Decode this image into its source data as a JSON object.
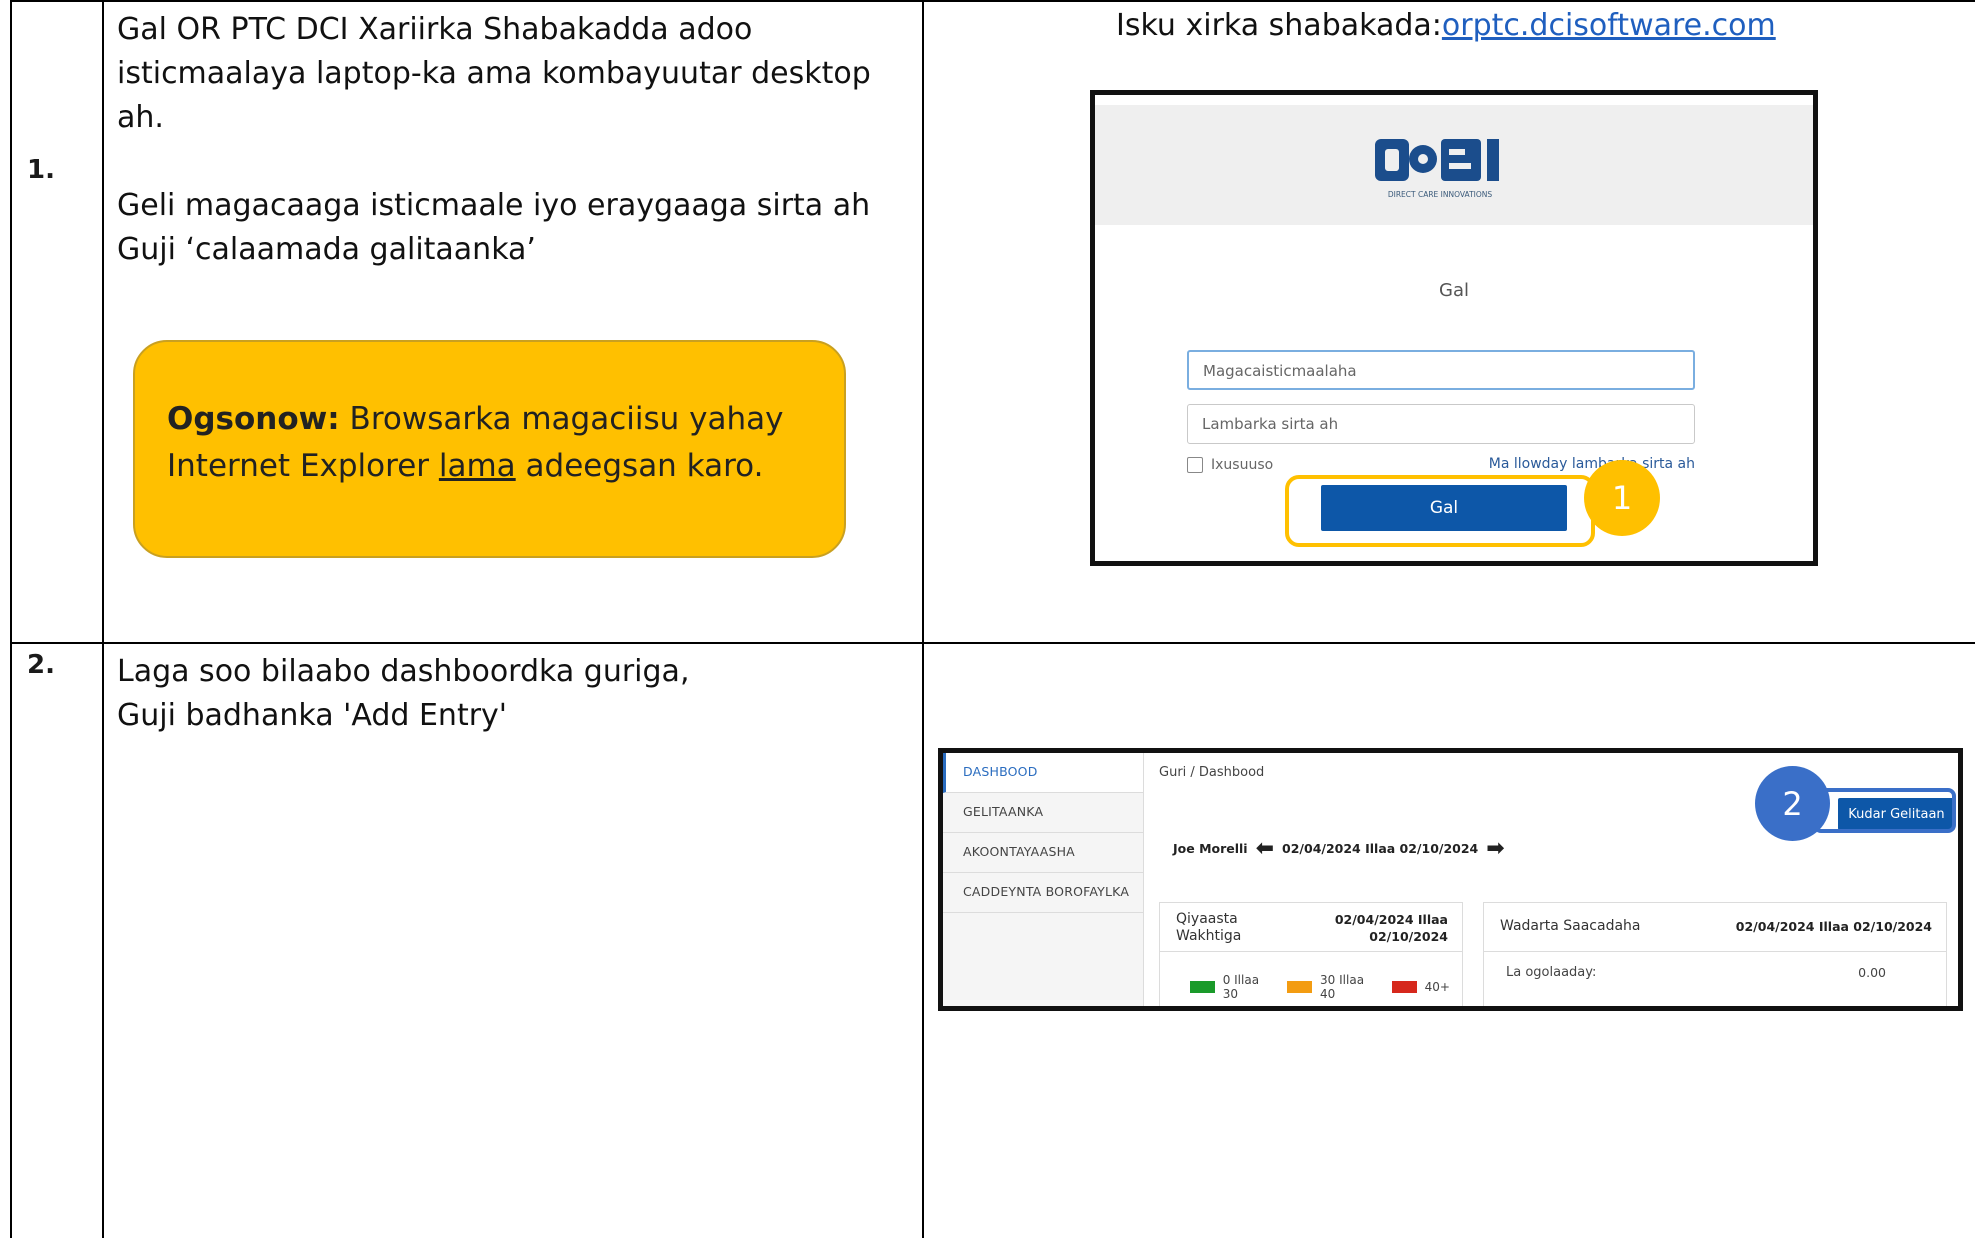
{
  "step1": {
    "number": "1.",
    "instructions": [
      "Gal OR PTC DCI Xariirka Shabakadda adoo",
      "isticmaalaya laptop-ka ama kombayuutar desktop",
      "ah.",
      "Geli magacaaga isticmaale iyo eraygaaga sirta ah",
      "Guji ‘calaamada galitaanka’"
    ],
    "note": {
      "label": "Ogsonow:",
      "text_before": " Browsarka magaciisu yahay Internet Explorer ",
      "underlined": "lama",
      "text_after": " adeegsan karo."
    },
    "link_prefix": "Isku xirka shabakada:",
    "link_text": "orptc.dcisoftware.com",
    "login": {
      "logo_caption": "DIRECT CARE INNOVATIONS",
      "title": "Gal",
      "username_placeholder": "Magacaisticmaalaha",
      "password_placeholder": "Lambarka sirta ah",
      "remember_label": "Ixusuuso",
      "forgot_link": "Ma llowday lambarka sirta ah",
      "login_button": "Gal",
      "callout_number": "1"
    }
  },
  "step2": {
    "number": "2.",
    "instructions": [
      "Laga soo bilaabo dashboordka guriga,",
      "Guji badhanka 'Add Entry'"
    ],
    "dashboard": {
      "sidebar": [
        "DASHBOOD",
        "GELITAANKA",
        "AKOONTAYAASHA",
        "CADDEYNTA BOROFAYLKA"
      ],
      "breadcrumb": "Guri / Dashbood",
      "add_button": "Kudar Gelitaan",
      "callout_number": "2",
      "user_name": "Joe Morelli",
      "date_range": "02/04/2024 Illaa 02/10/2024",
      "card_time": {
        "title_line1": "Qiyaasta",
        "title_line2": "Wakhtiga",
        "date_line1": "02/04/2024 Illaa",
        "date_line2": "02/10/2024",
        "legend": [
          "0 Illaa 30",
          "30 Illaa 40",
          "40+"
        ]
      },
      "card_hours": {
        "title": "Wadarta Saacadaha",
        "date": "02/04/2024 Illaa 02/10/2024",
        "overtime_label": "La ogolaaday:",
        "overtime_value": "0.00"
      }
    }
  },
  "colors": {
    "note_bg": "#ffc000",
    "primary_button": "#0d57a8",
    "callout1": "#ffc000",
    "callout2": "#3a6fc8",
    "legend_green": "#1a9a2a",
    "legend_orange": "#f39c12",
    "legend_red": "#d6281c"
  }
}
